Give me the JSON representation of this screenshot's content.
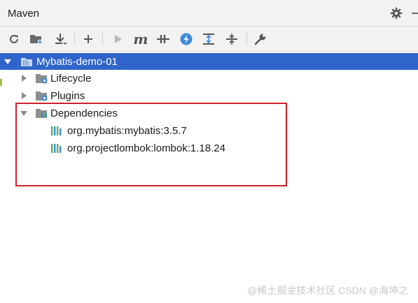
{
  "panel": {
    "title": "Maven"
  },
  "toolbar": {
    "buttons": [
      {
        "name": "reload-icon"
      },
      {
        "name": "add-folder-icon"
      },
      {
        "name": "download-icon"
      },
      {
        "name": "plus-icon"
      },
      {
        "name": "run-icon"
      },
      {
        "name": "execute-goal-icon",
        "label": "m"
      },
      {
        "name": "toggle-offline-icon"
      },
      {
        "name": "skip-tests-icon"
      },
      {
        "name": "expand-all-icon"
      },
      {
        "name": "collapse-all-icon"
      },
      {
        "name": "settings-wrench-icon"
      }
    ]
  },
  "tree": {
    "project": {
      "label": "Mybatis-demo-01"
    },
    "lifecycle": {
      "label": "Lifecycle"
    },
    "plugins": {
      "label": "Plugins"
    },
    "dependencies": {
      "label": "Dependencies",
      "items": [
        {
          "label": "org.mybatis:mybatis:3.5.7"
        },
        {
          "label": "org.projectlombok:lombok:1.18.24"
        }
      ]
    }
  },
  "watermark": {
    "text": "@稀土掘金技术社区 CSDN @海坤之"
  },
  "colors": {
    "selection": "#2f65ca",
    "highlight_border": "#d0212c",
    "header_bg": "#f2f2f2",
    "accent_blue": "#3f8ad8"
  }
}
